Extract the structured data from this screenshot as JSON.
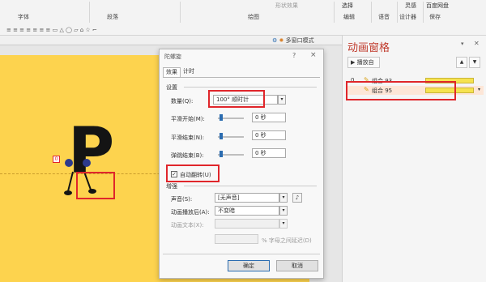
{
  "ribbon": {
    "groups": [
      "字体",
      "段落",
      "绘图",
      "编辑",
      "语音",
      "设计器",
      "保存"
    ],
    "top_items": [
      "选择",
      "灵感",
      "百度网盘"
    ],
    "shape_effect": "形状效果",
    "tool_row": "≡ ≡ ≡ ≡ ≡ ≡ ≡   ▭ △ ◯ ▱ ⌂ ☆ ⌐",
    "slide_toolbar_label": "多窗口模式"
  },
  "dialog": {
    "title": "陀螺旋",
    "tabs": [
      "效果",
      "计时"
    ],
    "settings_title": "设置",
    "amount_label": "数量(Q):",
    "amount_value": "100° 顺时针",
    "smooth_start_label": "平滑开始(M):",
    "smooth_start_value": "0 秒",
    "smooth_end_label": "平滑结束(N):",
    "smooth_end_value": "0 秒",
    "bounce_end_label": "弹跳结束(B):",
    "bounce_end_value": "0 秒",
    "auto_reverse_label": "自动翻转(U)",
    "auto_reverse_checked": true,
    "enhance_title": "增强",
    "sound_label": "声音(S):",
    "sound_value": "[无声音]",
    "after_anim_label": "动画播放后(A):",
    "after_anim_value": "不变暗",
    "anim_text_label": "动画文本(X):",
    "delay_label": "% 字母之间延迟(D)",
    "ok": "确定",
    "cancel": "取消",
    "help": "?",
    "close": "×"
  },
  "pane": {
    "title": "动画窗格",
    "play_label": "播放自",
    "items": [
      {
        "index": "0",
        "name": "组合 93"
      },
      {
        "index": "",
        "name": "组合 95"
      }
    ]
  },
  "canvas": {
    "letter": "P",
    "tag": "0"
  },
  "colors": {
    "slide": "#fdd34e",
    "accent_red": "#e0262b",
    "pane_title": "#c0392b",
    "timeline": "#f6e24f"
  }
}
